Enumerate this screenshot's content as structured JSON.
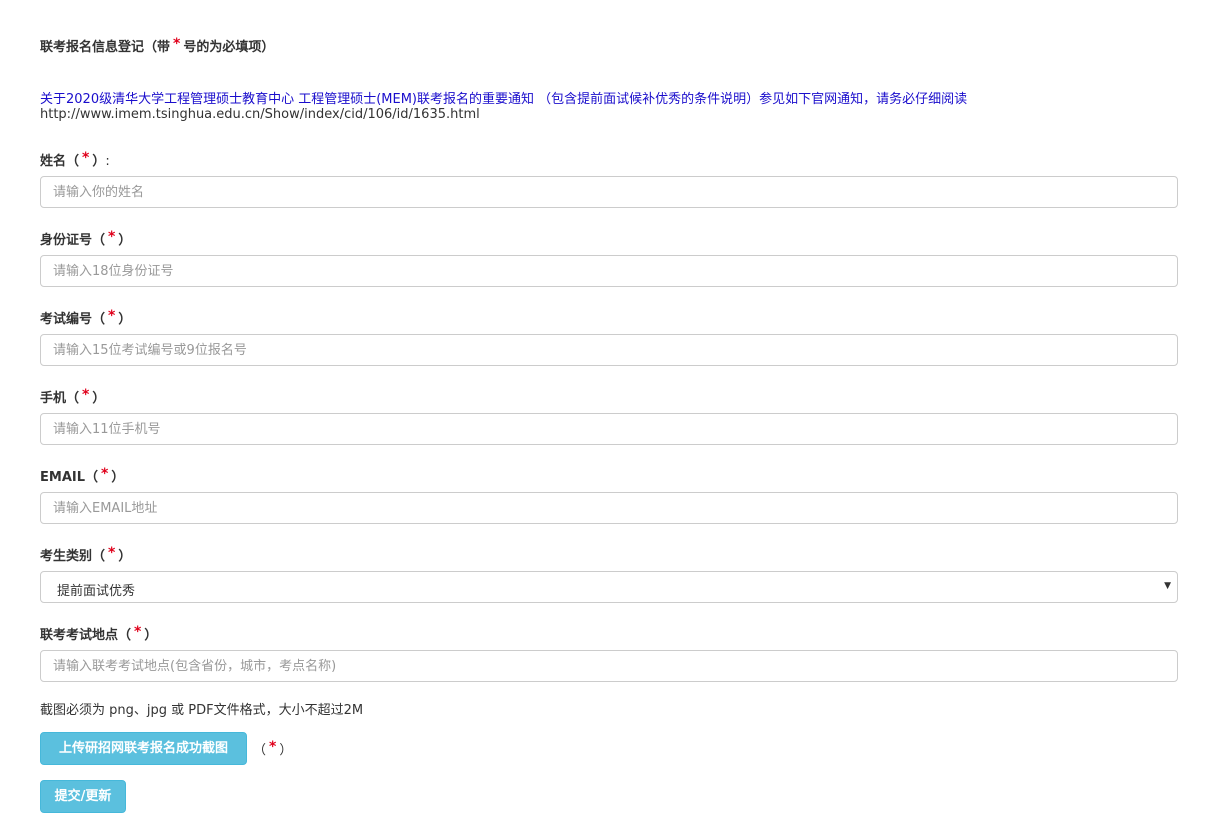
{
  "header": {
    "title_prefix": "联考报名信息登记（带",
    "required_mark": "*",
    "title_suffix": "号的为必填项）"
  },
  "notice": {
    "link_text": "关于2020级清华大学工程管理硕士教育中心 工程管理硕士(MEM)联考报名的重要通知 （包含提前面试候补优秀的条件说明）参见如下官网通知，请务必仔细阅读",
    "url": "http://www.imem.tsinghua.edu.cn/Show/index/cid/106/id/1635.html"
  },
  "labels": {
    "paren_open": "（",
    "paren_close": "）",
    "colon": ":",
    "required_mark": "*"
  },
  "fields": {
    "name": {
      "label": "姓名",
      "placeholder": "请输入你的姓名",
      "value": ""
    },
    "id_number": {
      "label": "身份证号",
      "placeholder": "请输入18位身份证号",
      "value": ""
    },
    "exam_number": {
      "label": "考试编号",
      "placeholder": "请输入15位考试编号或9位报名号",
      "value": ""
    },
    "phone": {
      "label": "手机",
      "placeholder": "请输入11位手机号",
      "value": ""
    },
    "email": {
      "label": "EMAIL",
      "placeholder": "请输入EMAIL地址",
      "value": ""
    },
    "category": {
      "label": "考生类别",
      "selected": "提前面试优秀"
    },
    "exam_location": {
      "label": "联考考试地点",
      "placeholder": "请输入联考考试地点(包含省份，城市，考点名称)",
      "value": ""
    }
  },
  "upload": {
    "hint": "截图必须为 png、jpg 或 PDF文件格式，大小不超过2M",
    "button_label": "上传研招网联考报名成功截图",
    "required_open": "（",
    "required_mark": "*",
    "required_close": "）"
  },
  "submit": {
    "button_label": "提交/更新"
  },
  "colors": {
    "required": "#e0001b",
    "link": "#1a0dcc",
    "button": "#5bc0de"
  }
}
